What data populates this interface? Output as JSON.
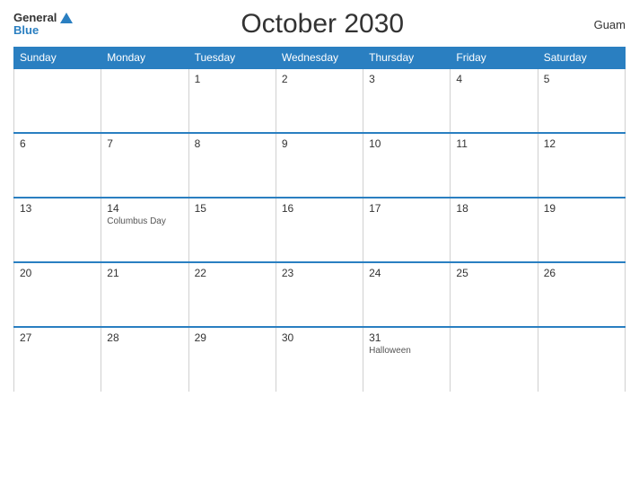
{
  "logo": {
    "general": "General",
    "blue": "Blue"
  },
  "title": "October 2030",
  "region": "Guam",
  "days_header": [
    "Sunday",
    "Monday",
    "Tuesday",
    "Wednesday",
    "Thursday",
    "Friday",
    "Saturday"
  ],
  "weeks": [
    [
      {
        "num": "",
        "event": "",
        "empty": true
      },
      {
        "num": "",
        "event": "",
        "empty": true
      },
      {
        "num": "1",
        "event": ""
      },
      {
        "num": "2",
        "event": ""
      },
      {
        "num": "3",
        "event": ""
      },
      {
        "num": "4",
        "event": ""
      },
      {
        "num": "5",
        "event": ""
      }
    ],
    [
      {
        "num": "6",
        "event": ""
      },
      {
        "num": "7",
        "event": ""
      },
      {
        "num": "8",
        "event": ""
      },
      {
        "num": "9",
        "event": ""
      },
      {
        "num": "10",
        "event": ""
      },
      {
        "num": "11",
        "event": ""
      },
      {
        "num": "12",
        "event": ""
      }
    ],
    [
      {
        "num": "13",
        "event": ""
      },
      {
        "num": "14",
        "event": "Columbus Day"
      },
      {
        "num": "15",
        "event": ""
      },
      {
        "num": "16",
        "event": ""
      },
      {
        "num": "17",
        "event": ""
      },
      {
        "num": "18",
        "event": ""
      },
      {
        "num": "19",
        "event": ""
      }
    ],
    [
      {
        "num": "20",
        "event": ""
      },
      {
        "num": "21",
        "event": ""
      },
      {
        "num": "22",
        "event": ""
      },
      {
        "num": "23",
        "event": ""
      },
      {
        "num": "24",
        "event": ""
      },
      {
        "num": "25",
        "event": ""
      },
      {
        "num": "26",
        "event": ""
      }
    ],
    [
      {
        "num": "27",
        "event": ""
      },
      {
        "num": "28",
        "event": ""
      },
      {
        "num": "29",
        "event": ""
      },
      {
        "num": "30",
        "event": ""
      },
      {
        "num": "31",
        "event": "Halloween"
      },
      {
        "num": "",
        "event": "",
        "empty": true
      },
      {
        "num": "",
        "event": "",
        "empty": true
      }
    ]
  ]
}
